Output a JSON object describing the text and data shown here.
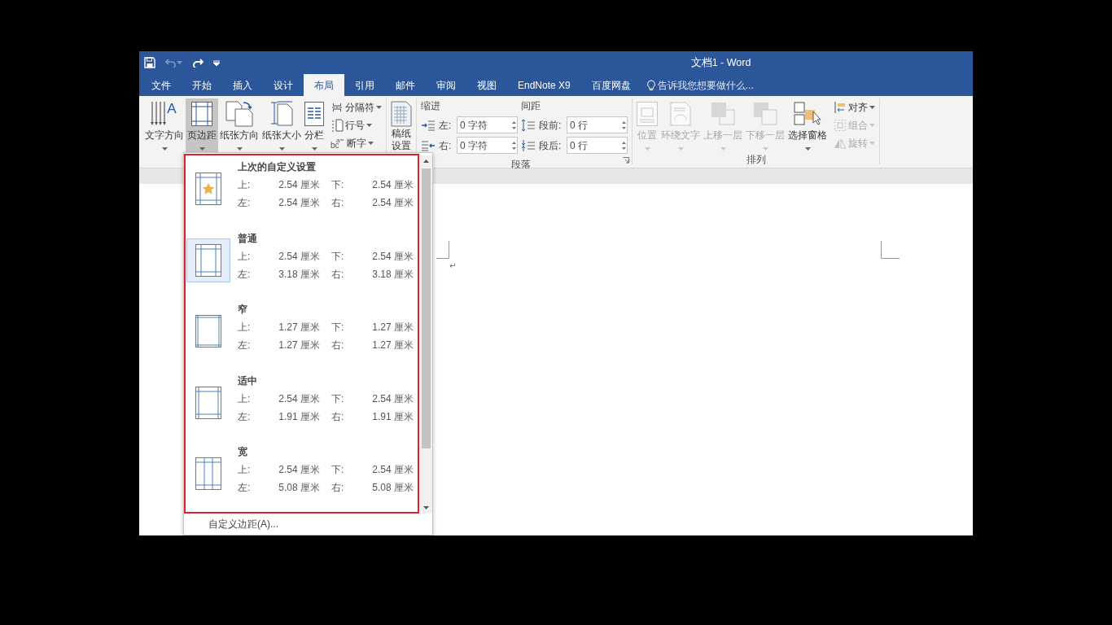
{
  "window": {
    "title": "文档1 - Word"
  },
  "quick_access": [
    {
      "kind": "save",
      "disabled": false
    },
    {
      "kind": "undo",
      "disabled": true
    },
    {
      "kind": "redo",
      "disabled": false
    },
    {
      "kind": "customize",
      "disabled": false
    }
  ],
  "tabs": [
    {
      "label": "文件",
      "selected": false
    },
    {
      "label": "开始",
      "selected": false
    },
    {
      "label": "插入",
      "selected": false
    },
    {
      "label": "设计",
      "selected": false
    },
    {
      "label": "布局",
      "selected": true
    },
    {
      "label": "引用",
      "selected": false
    },
    {
      "label": "邮件",
      "selected": false
    },
    {
      "label": "审阅",
      "selected": false
    },
    {
      "label": "视图",
      "selected": false
    },
    {
      "label": "EndNote X9",
      "selected": false
    },
    {
      "label": "百度网盘",
      "selected": false
    }
  ],
  "tell_me": {
    "placeholder": "告诉我您想要做什么..."
  },
  "ribbon": {
    "page_setup": {
      "large_buttons": [
        {
          "kind": "text_direction",
          "label": "文字方向",
          "pressed": false,
          "icon_text": "A"
        },
        {
          "kind": "margins",
          "label": "页边距",
          "pressed": true
        },
        {
          "kind": "orientation",
          "label": "纸张方向",
          "pressed": false
        },
        {
          "kind": "size",
          "label": "纸张大小",
          "pressed": false
        },
        {
          "kind": "columns",
          "label": "分栏",
          "pressed": false
        }
      ],
      "small_buttons": [
        {
          "kind": "breaks",
          "label": "分隔符"
        },
        {
          "kind": "line_numbers",
          "label": "行号"
        },
        {
          "kind": "hyphenation",
          "label": "断字",
          "icon_text": "bc",
          "icon_superscript": "a"
        }
      ]
    },
    "manuscript": {
      "label": "稿纸设置"
    },
    "paragraph": {
      "title": "段落",
      "indent": {
        "title": "缩进",
        "fields": [
          {
            "kind": "indent_left",
            "label": "左:",
            "value": "0 字符"
          },
          {
            "kind": "indent_right",
            "label": "右:",
            "value": "0 字符"
          }
        ]
      },
      "spacing": {
        "title": "间距",
        "fields": [
          {
            "kind": "space_before",
            "label": "段前:",
            "value": "0 行"
          },
          {
            "kind": "space_after",
            "label": "段后:",
            "value": "0 行"
          }
        ]
      }
    },
    "arrange": {
      "title": "排列",
      "large_buttons": [
        {
          "kind": "position",
          "label": "位置",
          "disabled": true
        },
        {
          "kind": "wrap",
          "label": "环绕文字",
          "disabled": true
        },
        {
          "kind": "forward",
          "label": "上移一层",
          "disabled": true
        },
        {
          "kind": "backward",
          "label": "下移一层",
          "disabled": true
        },
        {
          "kind": "pane",
          "label": "选择窗格",
          "disabled": false
        }
      ],
      "small_buttons": [
        {
          "kind": "align",
          "label": "对齐",
          "disabled": false
        },
        {
          "kind": "group",
          "label": "组合",
          "disabled": true
        },
        {
          "kind": "rotate",
          "label": "旋转",
          "disabled": true
        }
      ]
    }
  },
  "document": {
    "paragraph_mark": "↵"
  },
  "margins_menu": {
    "presets": [
      {
        "kind": "last_custom",
        "name": "上次的自定义设置",
        "selected": false,
        "margins": [
          {
            "label": "上:",
            "value": "2.54 厘米"
          },
          {
            "label": "下:",
            "value": "2.54 厘米"
          },
          {
            "label": "左:",
            "value": "2.54 厘米"
          },
          {
            "label": "右:",
            "value": "2.54 厘米"
          }
        ]
      },
      {
        "kind": "normal",
        "name": "普通",
        "selected": true,
        "margins": [
          {
            "label": "上:",
            "value": "2.54 厘米"
          },
          {
            "label": "下:",
            "value": "2.54 厘米"
          },
          {
            "label": "左:",
            "value": "3.18 厘米"
          },
          {
            "label": "右:",
            "value": "3.18 厘米"
          }
        ]
      },
      {
        "kind": "narrow",
        "name": "窄",
        "selected": false,
        "margins": [
          {
            "label": "上:",
            "value": "1.27 厘米"
          },
          {
            "label": "下:",
            "value": "1.27 厘米"
          },
          {
            "label": "左:",
            "value": "1.27 厘米"
          },
          {
            "label": "右:",
            "value": "1.27 厘米"
          }
        ]
      },
      {
        "kind": "moderate",
        "name": "适中",
        "selected": false,
        "margins": [
          {
            "label": "上:",
            "value": "2.54 厘米"
          },
          {
            "label": "下:",
            "value": "2.54 厘米"
          },
          {
            "label": "左:",
            "value": "1.91 厘米"
          },
          {
            "label": "右:",
            "value": "1.91 厘米"
          }
        ]
      },
      {
        "kind": "wide",
        "name": "宽",
        "selected": false,
        "margins": [
          {
            "label": "上:",
            "value": "2.54 厘米"
          },
          {
            "label": "下:",
            "value": "2.54 厘米"
          },
          {
            "label": "左:",
            "value": "5.08 厘米"
          },
          {
            "label": "右:",
            "value": "5.08 厘米"
          }
        ]
      }
    ],
    "footer": "自定义边距(A)..."
  }
}
